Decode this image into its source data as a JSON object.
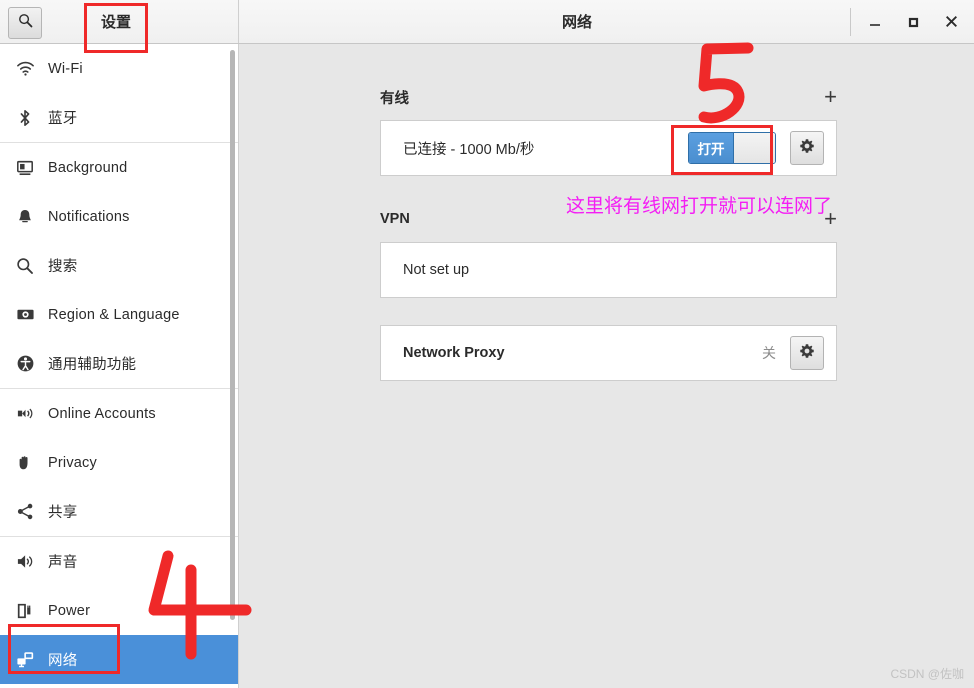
{
  "window": {
    "title": "网络",
    "settings_tab_label": "设置",
    "search_icon": "search-icon",
    "controls": {
      "minimize": "minimize-icon",
      "maximize": "maximize-icon",
      "close": "close-icon"
    }
  },
  "sidebar": {
    "items": [
      {
        "label": "Wi-Fi",
        "icon": "wifi-icon",
        "selected": false
      },
      {
        "label": "蓝牙",
        "icon": "bluetooth-icon",
        "selected": false
      },
      {
        "label": "Background",
        "icon": "background-icon",
        "selected": false
      },
      {
        "label": "Notifications",
        "icon": "bell-icon",
        "selected": false
      },
      {
        "label": "搜索",
        "icon": "search-icon",
        "selected": false
      },
      {
        "label": "Region & Language",
        "icon": "region-language-icon",
        "selected": false
      },
      {
        "label": "通用辅助功能",
        "icon": "accessibility-icon",
        "selected": false
      },
      {
        "label": "Online Accounts",
        "icon": "online-accounts-icon",
        "selected": false
      },
      {
        "label": "Privacy",
        "icon": "hand-icon",
        "selected": false
      },
      {
        "label": "共享",
        "icon": "share-icon",
        "selected": false
      },
      {
        "label": "声音",
        "icon": "speaker-icon",
        "selected": false
      },
      {
        "label": "Power",
        "icon": "power-plug-icon",
        "selected": false
      },
      {
        "label": "网络",
        "icon": "network-icon",
        "selected": true
      }
    ]
  },
  "main": {
    "wired": {
      "title": "有线",
      "add_label": "+",
      "status": "已连接 - 1000 Mb/秒",
      "toggle_label": "打开",
      "toggle_state": "on",
      "settings_icon": "gear-icon"
    },
    "vpn": {
      "title": "VPN",
      "add_label": "+",
      "status": "Not set up"
    },
    "proxy": {
      "title": "Network Proxy",
      "state": "关",
      "settings_icon": "gear-icon"
    }
  },
  "annotations": {
    "step4": "4",
    "step5": "5",
    "note": "这里将有线网打开就可以连网了",
    "note_color": "#f41ef4",
    "box_color": "#ef2929"
  },
  "watermark": "CSDN @佐咖",
  "colors": {
    "accent": "#4a90d9",
    "sidebar_bg": "#ffffff",
    "content_bg": "#e7e7e7",
    "annotation_red": "#ef2929",
    "annotation_magenta": "#f41ef4"
  }
}
